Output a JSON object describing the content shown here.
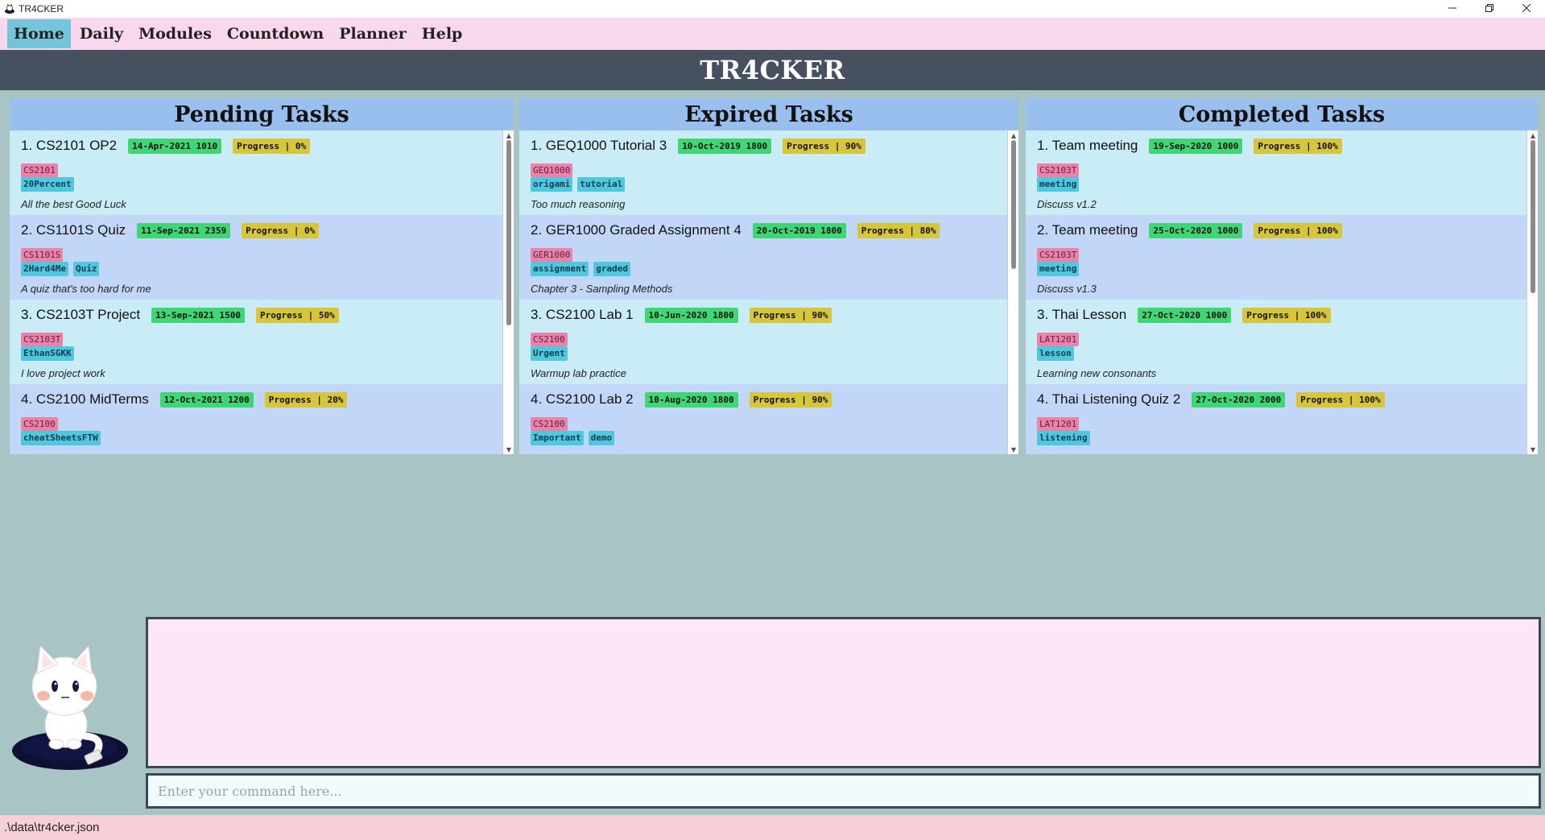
{
  "window": {
    "title": "TR4CKER"
  },
  "menu": [
    {
      "label": "Home",
      "active": true
    },
    {
      "label": "Daily",
      "active": false
    },
    {
      "label": "Modules",
      "active": false
    },
    {
      "label": "Countdown",
      "active": false
    },
    {
      "label": "Planner",
      "active": false
    },
    {
      "label": "Help",
      "active": false
    }
  ],
  "header": {
    "brand": "TR4CKER"
  },
  "panels": {
    "pending": {
      "title": "Pending Tasks",
      "tasks": [
        {
          "index": "1.",
          "name": "CS2101 OP2",
          "date": "14-Apr-2021 1010",
          "progress": "Progress | 0%",
          "module": "CS2101",
          "tags": [
            "20Percent"
          ],
          "desc": "All the best Good Luck"
        },
        {
          "index": "2.",
          "name": "CS1101S Quiz",
          "date": "11-Sep-2021 2359",
          "progress": "Progress | 0%",
          "module": "CS1101S",
          "tags": [
            "2Hard4Me",
            "Quiz"
          ],
          "desc": "A quiz that's too hard for me"
        },
        {
          "index": "3.",
          "name": "CS2103T Project",
          "date": "13-Sep-2021 1500",
          "progress": "Progress | 50%",
          "module": "CS2103T",
          "tags": [
            "EthanSGKK"
          ],
          "desc": "I love project work"
        },
        {
          "index": "4.",
          "name": "CS2100 MidTerms",
          "date": "12-Oct-2021 1200",
          "progress": "Progress | 20%",
          "module": "CS2100",
          "tags": [
            "cheatSheetsFTW"
          ],
          "desc": ""
        }
      ]
    },
    "expired": {
      "title": "Expired Tasks",
      "tasks": [
        {
          "index": "1.",
          "name": "GEQ1000 Tutorial 3",
          "date": "10-Oct-2019 1800",
          "progress": "Progress | 90%",
          "module": "GEQ1000",
          "tags": [
            "origami",
            "tutorial"
          ],
          "desc": "Too much reasoning"
        },
        {
          "index": "2.",
          "name": "GER1000 Graded Assignment 4",
          "date": "20-Oct-2019 1800",
          "progress": "Progress | 80%",
          "module": "GER1000",
          "tags": [
            "assignment",
            "graded"
          ],
          "desc": "Chapter 3 - Sampling Methods"
        },
        {
          "index": "3.",
          "name": "CS2100 Lab 1",
          "date": "10-Jun-2020 1800",
          "progress": "Progress | 90%",
          "module": "CS2100",
          "tags": [
            "Urgent"
          ],
          "desc": "Warmup lab practice"
        },
        {
          "index": "4.",
          "name": "CS2100 Lab 2",
          "date": "10-Aug-2020 1800",
          "progress": "Progress | 90%",
          "module": "CS2100",
          "tags": [
            "Important",
            "demo"
          ],
          "desc": ""
        }
      ]
    },
    "completed": {
      "title": "Completed Tasks",
      "tasks": [
        {
          "index": "1.",
          "name": "Team meeting",
          "date": "19-Sep-2020 1000",
          "progress": "Progress | 100%",
          "module": "CS2103T",
          "tags": [
            "meeting"
          ],
          "desc": "Discuss v1.2"
        },
        {
          "index": "2.",
          "name": "Team meeting",
          "date": "25-Oct-2020 1000",
          "progress": "Progress | 100%",
          "module": "CS2103T",
          "tags": [
            "meeting"
          ],
          "desc": "Discuss v1.3"
        },
        {
          "index": "3.",
          "name": "Thai Lesson",
          "date": "27-Oct-2020 1000",
          "progress": "Progress | 100%",
          "module": "LAT1201",
          "tags": [
            "lesson"
          ],
          "desc": "Learning new consonants"
        },
        {
          "index": "4.",
          "name": "Thai Listening Quiz 2",
          "date": "27-Oct-2020 2000",
          "progress": "Progress | 100%",
          "module": "LAT1201",
          "tags": [
            "listening"
          ],
          "desc": ""
        }
      ]
    }
  },
  "command": {
    "placeholder": "Enter your command here...",
    "value": ""
  },
  "result": {
    "text": ""
  },
  "status": {
    "path": ".\\data\\tr4cker.json"
  },
  "icons": {
    "app": "cat-app-icon",
    "minimize": "minimize-icon",
    "maximize": "restore-icon",
    "close": "close-icon",
    "mascot": "cat-mascot-icon"
  },
  "colors": {
    "menubar": "#f8d8ec",
    "menu_active": "#73c6d9",
    "header": "#46505e",
    "panel_head": "#98bfee",
    "date_badge": "#3fd674",
    "progress_badge": "#d7c63a",
    "module_badge": "#e983a9",
    "tag_badge": "#4fc7de"
  }
}
